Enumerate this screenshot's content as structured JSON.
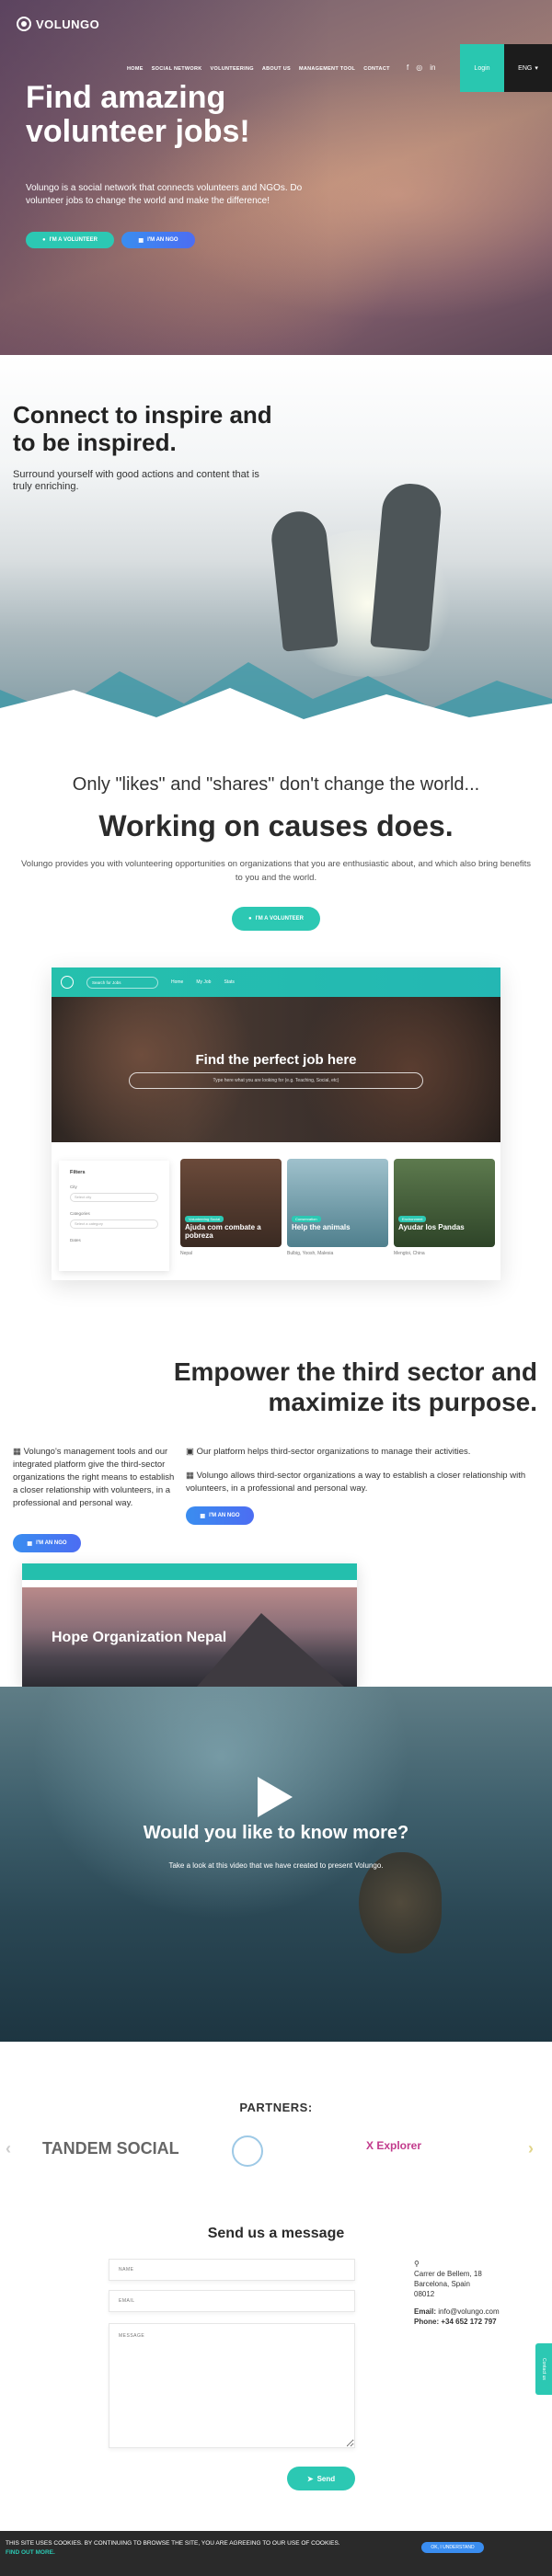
{
  "header": {
    "logo_text": "VOLUNGO",
    "nav": [
      "HOME",
      "SOCIAL NETWORK",
      "VOLUNTEERING",
      "ABOUT US",
      "MANAGEMENT TOOL",
      "CONTACT"
    ],
    "social_icons": [
      "facebook-icon",
      "instagram-icon",
      "linkedin-icon"
    ],
    "login_label": "Login",
    "lang_label": "ENG"
  },
  "hero": {
    "title": "Find amazing volunteer jobs!",
    "subtitle": "Volungo is a social network that connects volunteers and NGOs. Do volunteer jobs to change the world and make the difference!",
    "btn_volunteer": "I'M A VOLUNTEER",
    "btn_ngo": "I'M AN NGO"
  },
  "inspire": {
    "title": "Connect to inspire and to be inspired.",
    "text": "Surround yourself with good actions and content that is truly enriching."
  },
  "causes": {
    "question": "Only \"likes\" and \"shares\" don't change the world...",
    "headline": "Working on causes does.",
    "text": "Volungo provides you with volunteering opportunities on organizations that you are enthusiastic about, and which also bring benefits to you and the world.",
    "btn": "I'M A VOLUNTEER"
  },
  "mockup": {
    "search_placeholder": "Search for Jobs",
    "nav": [
      "Home",
      "My Job",
      "Stats"
    ],
    "title": "Find the perfect job here",
    "search_big": "Type here what you are looking for (e.g. Teaching, Social, etc)",
    "filters_title": "Filters",
    "filter_city": "City",
    "filter_city_placeholder": "Select city",
    "filter_category": "Categories",
    "filter_category_placeholder": "Select a category",
    "filter_more": "Dates",
    "cards": [
      {
        "tag": "Volunteering Social",
        "title": "Ajuda com combate a pobreza",
        "loc": "Nepal"
      },
      {
        "tag": "Conservation",
        "title": "Help the animals",
        "loc": "Bulbig, Yoosh, Malesia"
      },
      {
        "tag": "Environment",
        "title": "Ayudar los Pandas",
        "loc": "Mengtoi, China"
      }
    ]
  },
  "empower": {
    "headline": "Empower the third sector and maximize its purpose.",
    "col1": "Volungo's management tools and our integrated platform give the third-sector organizations the right means to establish a closer relationship with volunteers, in a professional and personal way.",
    "col2_a": "Our platform helps third-sector organizations to manage their activities.",
    "col2_b": "Volungo allows third-sector organizations a way to establish a closer relationship with volunteers, in a professional and personal way.",
    "btn1": "I'M AN NGO",
    "btn2": "I'M AN NGO",
    "mock_title": "Hope Organization Nepal"
  },
  "video": {
    "title": "Would you like to know more?",
    "text": "Take a look at this video that we have created to present Volungo."
  },
  "partners": {
    "title": "PARTNERS:",
    "items": [
      "TANDEM SOCIAL",
      "X Explorer"
    ]
  },
  "contact": {
    "title": "Send us a message",
    "name_placeholder": "NAME",
    "email_placeholder": "EMAIL",
    "message_placeholder": "MESSAGE",
    "send_label": "Send",
    "address1": "Carrer de Bellem, 18",
    "address2": "Barcelona, Spain",
    "address3": "08012",
    "email_label": "Email:",
    "email": "info@volungo.com",
    "phone_label": "Phone:",
    "phone": "+34 652 172 797",
    "side_tab": "Contact us"
  },
  "cookie": {
    "text": "THIS SITE USES COOKIES. BY CONTINUING TO BROWSE THE SITE, YOU ARE AGREEING TO OUR USE OF COOKIES.",
    "more": "FIND OUT MORE.",
    "btn": "OK, I UNDERSTAND"
  },
  "colors": {
    "teal": "#2cc8b3",
    "blue": "#3a8df0",
    "dark": "#2b2b2b"
  }
}
